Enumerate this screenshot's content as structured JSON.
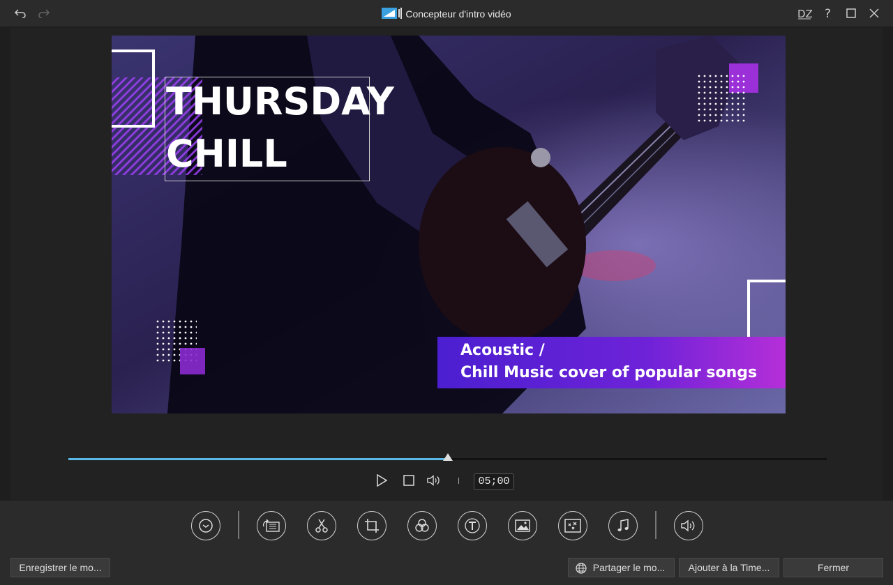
{
  "window": {
    "title": "Concepteur d'intro vidéo"
  },
  "preview": {
    "title_line1": "THURSDAY",
    "title_line2": "CHILL",
    "subtitle_line1": "Acoustic /",
    "subtitle_line2": "Chill Music cover of popular songs"
  },
  "playback": {
    "time": "05;00",
    "progress": 0.5
  },
  "tools": [
    {
      "name": "duration-tool",
      "icon": "clock-icon"
    },
    {
      "name": "replace-tool",
      "icon": "replace-media-icon"
    },
    {
      "name": "trim-tool",
      "icon": "scissors-icon"
    },
    {
      "name": "crop-tool",
      "icon": "crop-icon"
    },
    {
      "name": "color-tool",
      "icon": "color-circles-icon"
    },
    {
      "name": "text-tool",
      "icon": "text-icon"
    },
    {
      "name": "image-tool",
      "icon": "image-icon"
    },
    {
      "name": "particle-tool",
      "icon": "particle-icon"
    },
    {
      "name": "music-tool",
      "icon": "music-note-icon"
    },
    {
      "name": "volume-tool",
      "icon": "speaker-icon"
    }
  ],
  "footer": {
    "save_label": "Enregistrer le mo...",
    "share_label": "Partager le mo...",
    "add_timeline_label": "Ajouter à la Time...",
    "close_label": "Fermer"
  },
  "colors": {
    "accent": "#5bb8e6",
    "banner_start": "#4b1fd0",
    "banner_end": "#b52fd8",
    "highlight": "#8a2be2"
  }
}
